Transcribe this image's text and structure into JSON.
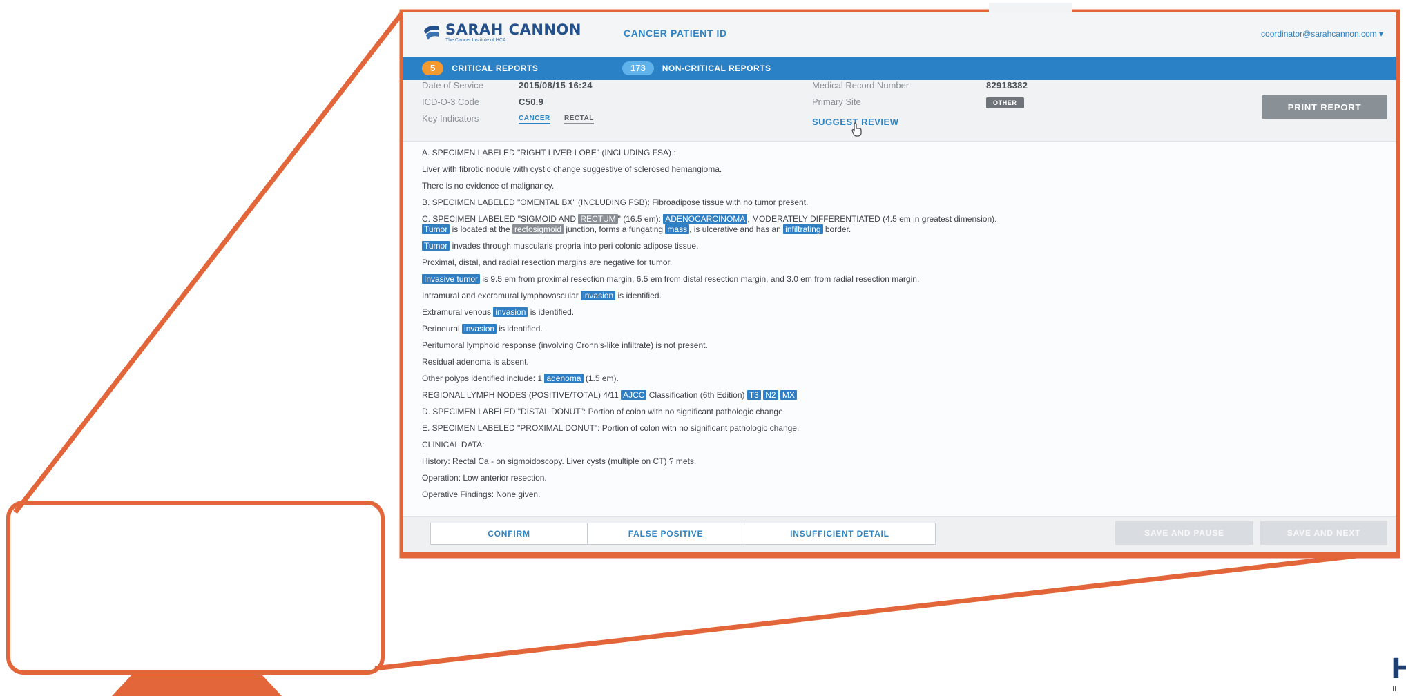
{
  "colors": {
    "frame": "#e2663a",
    "tab_bar": "#2b81c5",
    "highlight": "#2f7fc4",
    "critical_badge": "#f29a30"
  },
  "header": {
    "brand_name": "SARAH CANNON",
    "brand_sub": "The Cancer Institute of HCA",
    "brand_icon": "sarah-cannon-logo",
    "app_name": "CANCER PATIENT ID",
    "user_email": "coordinator@sarahcannon.com ▾"
  },
  "tabs": {
    "critical": {
      "count": "5",
      "label": "CRITICAL REPORTS"
    },
    "non_critical": {
      "count": "173",
      "label": "NON-CRITICAL REPORTS"
    }
  },
  "meta": {
    "date_label": "Date of Service",
    "date_value": "2015/08/15 16:24",
    "icd_label": "ICD-O-3 Code",
    "icd_value": "C50.9",
    "key_label": "Key Indicators",
    "key_1": "CANCER",
    "key_2": "RECTAL",
    "mrn_label": "Medical Record Number",
    "mrn_value": "82918382",
    "site_label": "Primary Site",
    "site_value": "OTHER",
    "suggest": "SUGGEST REVIEW",
    "print": "PRINT REPORT"
  },
  "report": {
    "l01": "A. SPECIMEN LABELED \"RIGHT LIVER LOBE\" (INCLUDING FSA) :",
    "l02": "Liver with fibrotic nodule with cystic change suggestive of sclerosed hemangioma.",
    "l03": "There is no evidence of malignancy.",
    "l04": "B. SPECIMEN LABELED \"OMENTAL BX\" (INCLUDING FSB): Fibroadipose tissue with no tumor present.",
    "l05a": "C. SPECIMEN LABELED \"SIGMOID AND ",
    "l05b": "RECTUM",
    "l05c": "\" (16.5 em): ",
    "l05d": "ADENOCARCINOMA",
    "l05e": ", MODERATELY DIFFERENTIATED (4.5 em in greatest dimension).",
    "l06a": "Tumor",
    "l06b": " is located at the ",
    "l06c": "rectosigmoid",
    "l06d": " junction, forms a fungating ",
    "l06e": "mass",
    "l06f": ", is ulcerative and has an ",
    "l06g": "infiltrating",
    "l06h": " border.",
    "l07a": "Tumor",
    "l07b": " invades through muscularis propria into peri colonic adipose tissue.",
    "l08": "Proximal, distal, and radial resection margins are negative for tumor.",
    "l09a": "Invasive tumor",
    "l09b": " is 9.5 em from proximal resection margin, 6.5 em from distal resection margin, and 3.0 em from radial resection margin.",
    "l10a": "Intramural and excramural lymphovascular ",
    "l10b": "invasion",
    "l10c": " is identified.",
    "l11a": "Extramural venous ",
    "l11b": "invasion",
    "l11c": " is identified.",
    "l12a": "Perineural ",
    "l12b": "invasion",
    "l12c": " is identified.",
    "l13": "Peritumoral lymphoid response (involving Crohn's-like infiltrate) is not present.",
    "l14": "Residual adenoma is absent.",
    "l15a": "Other polyps identified include: 1 ",
    "l15b": "adenoma",
    "l15c": " (1.5 em).",
    "l16a": "REGIONAL LYMPH NODES (POSITIVE/TOTAL) 4/11 ",
    "l16b": "AJCC",
    "l16c": " Classification (6th Edition) ",
    "l16d": "T3",
    "l16e": "N2",
    "l16f": "MX",
    "l17": "D. SPECIMEN LABELED \"DISTAL DONUT\": Portion of colon with no significant pathologic change.",
    "l18": "E. SPECIMEN LABELED \"PROXIMAL DONUT\": Portion of colon with no significant pathologic change.",
    "l19": "CLINICAL DATA:",
    "l20": "History: Rectal Ca - on sigmoidoscopy. Liver cysts (multiple on CT) ? mets.",
    "l21": "Operation: Low anterior resection.",
    "l22": "Operative Findings: None given."
  },
  "actions": {
    "confirm": "CONFIRM",
    "false_positive": "FALSE POSITIVE",
    "insufficient": "INSUFFICIENT DETAIL",
    "save_pause": "SAVE AND PAUSE",
    "save_next": "SAVE AND NEXT"
  },
  "corner": {
    "logo": "H",
    "sub": "II"
  }
}
